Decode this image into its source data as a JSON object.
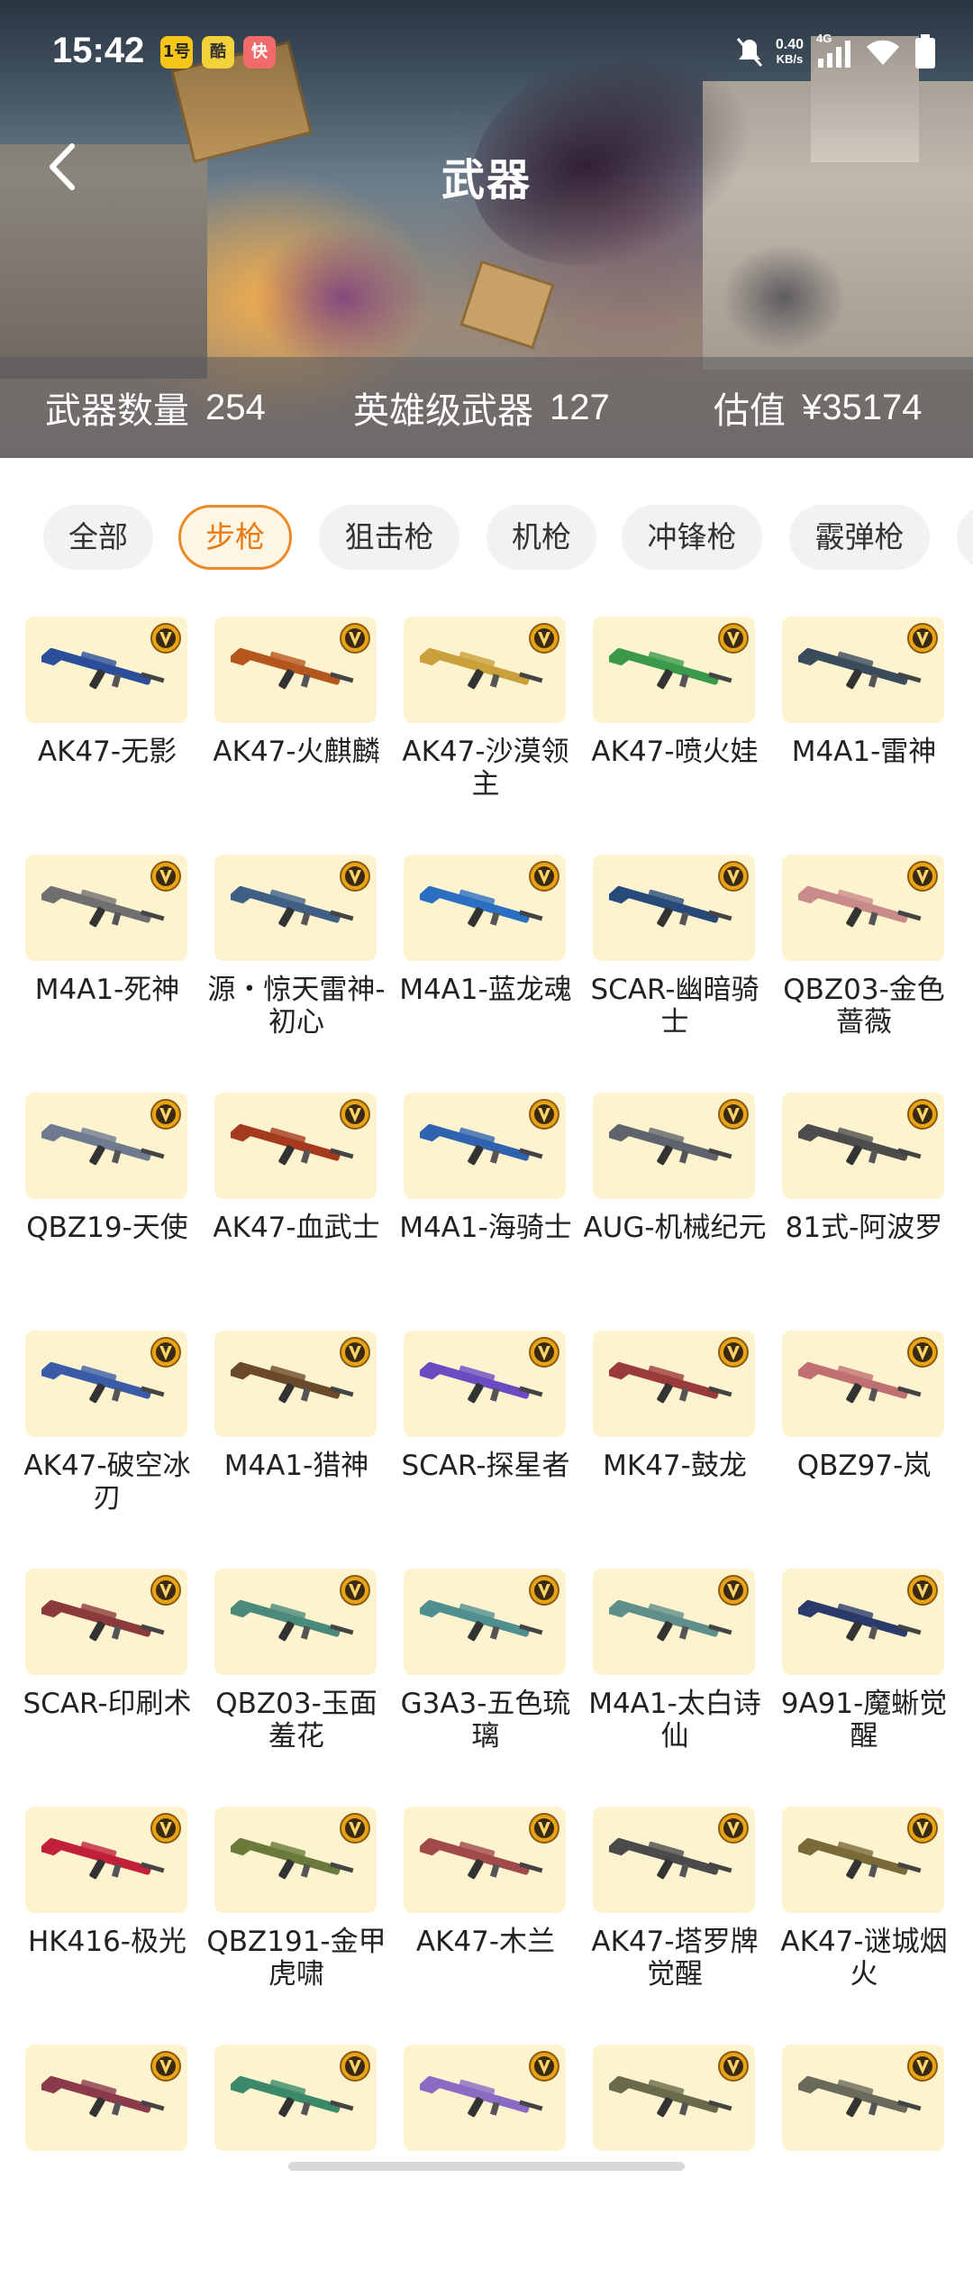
{
  "status_bar": {
    "time": "15:42",
    "app_icons": [
      "1号",
      "酷",
      "快"
    ],
    "net_speed_value": "0.40",
    "net_speed_unit": "KB/s",
    "network": "4G"
  },
  "header": {
    "title": "武器"
  },
  "stats": {
    "weapon_count_label": "武器数量",
    "weapon_count": "254",
    "hero_weapon_label": "英雄级武器",
    "hero_weapon_count": "127",
    "value_label": "估值",
    "value": "¥35174"
  },
  "filters": [
    {
      "label": "全部",
      "active": false
    },
    {
      "label": "步枪",
      "active": true
    },
    {
      "label": "狙击枪",
      "active": false
    },
    {
      "label": "机枪",
      "active": false
    },
    {
      "label": "冲锋枪",
      "active": false
    },
    {
      "label": "霰弹枪",
      "active": false
    }
  ],
  "weapons": [
    {
      "name": "AK47-无影",
      "color": "#2a4e9a"
    },
    {
      "name": "AK47-火麒麟",
      "color": "#b5561f"
    },
    {
      "name": "AK47-沙漠领主",
      "color": "#c9a03a"
    },
    {
      "name": "AK47-喷火娃",
      "color": "#3b9a4a"
    },
    {
      "name": "M4A1-雷神",
      "color": "#3a4b5c"
    },
    {
      "name": "M4A1-死神",
      "color": "#6f6f6f"
    },
    {
      "name": "源・惊天雷神-初心",
      "color": "#3f5f86"
    },
    {
      "name": "M4A1-蓝龙魂",
      "color": "#2b6fc2"
    },
    {
      "name": "SCAR-幽暗骑士",
      "color": "#274a7a"
    },
    {
      "name": "QBZ03-金色蔷薇",
      "color": "#c98a8a"
    },
    {
      "name": "QBZ19-天使",
      "color": "#6e7b8f"
    },
    {
      "name": "AK47-血武士",
      "color": "#a53a1f"
    },
    {
      "name": "M4A1-海骑士",
      "color": "#2f63b0"
    },
    {
      "name": "AUG-机械纪元",
      "color": "#5f636b"
    },
    {
      "name": "81式-阿波罗",
      "color": "#4c4c4c"
    },
    {
      "name": "AK47-破空冰刃",
      "color": "#3a5ca8"
    },
    {
      "name": "M4A1-猎神",
      "color": "#6b4a2a"
    },
    {
      "name": "SCAR-探星者",
      "color": "#6a4bc2"
    },
    {
      "name": "MK47-鼓龙",
      "color": "#9a3a3a"
    },
    {
      "name": "QBZ97-岚",
      "color": "#c07070"
    },
    {
      "name": "SCAR-印刷术",
      "color": "#8a3a3a"
    },
    {
      "name": "QBZ03-玉面羞花",
      "color": "#4a8a7a"
    },
    {
      "name": "G3A3-五色琉璃",
      "color": "#4f8f8f"
    },
    {
      "name": "M4A1-太白诗仙",
      "color": "#5f8f8a"
    },
    {
      "name": "9A91-魔蜥觉醒",
      "color": "#2a3a6a"
    },
    {
      "name": "HK416-极光",
      "color": "#c2203a"
    },
    {
      "name": "QBZ191-金甲虎啸",
      "color": "#6a7a3a"
    },
    {
      "name": "AK47-木兰",
      "color": "#a04a4a"
    },
    {
      "name": "AK47-塔罗牌觉醒",
      "color": "#4a4a4a"
    },
    {
      "name": "AK47-谜城烟火",
      "color": "#7a6a3a"
    },
    {
      "name": "",
      "color": "#8a3a4a"
    },
    {
      "name": "",
      "color": "#3a8a6a"
    },
    {
      "name": "",
      "color": "#8a6ac2"
    },
    {
      "name": "",
      "color": "#6a6a4a"
    },
    {
      "name": "",
      "color": "#6a6a5a"
    }
  ],
  "colors": {
    "accent": "#ea7a14",
    "thumb_bg": "#fdf3cf",
    "badge": "#e8a317"
  }
}
